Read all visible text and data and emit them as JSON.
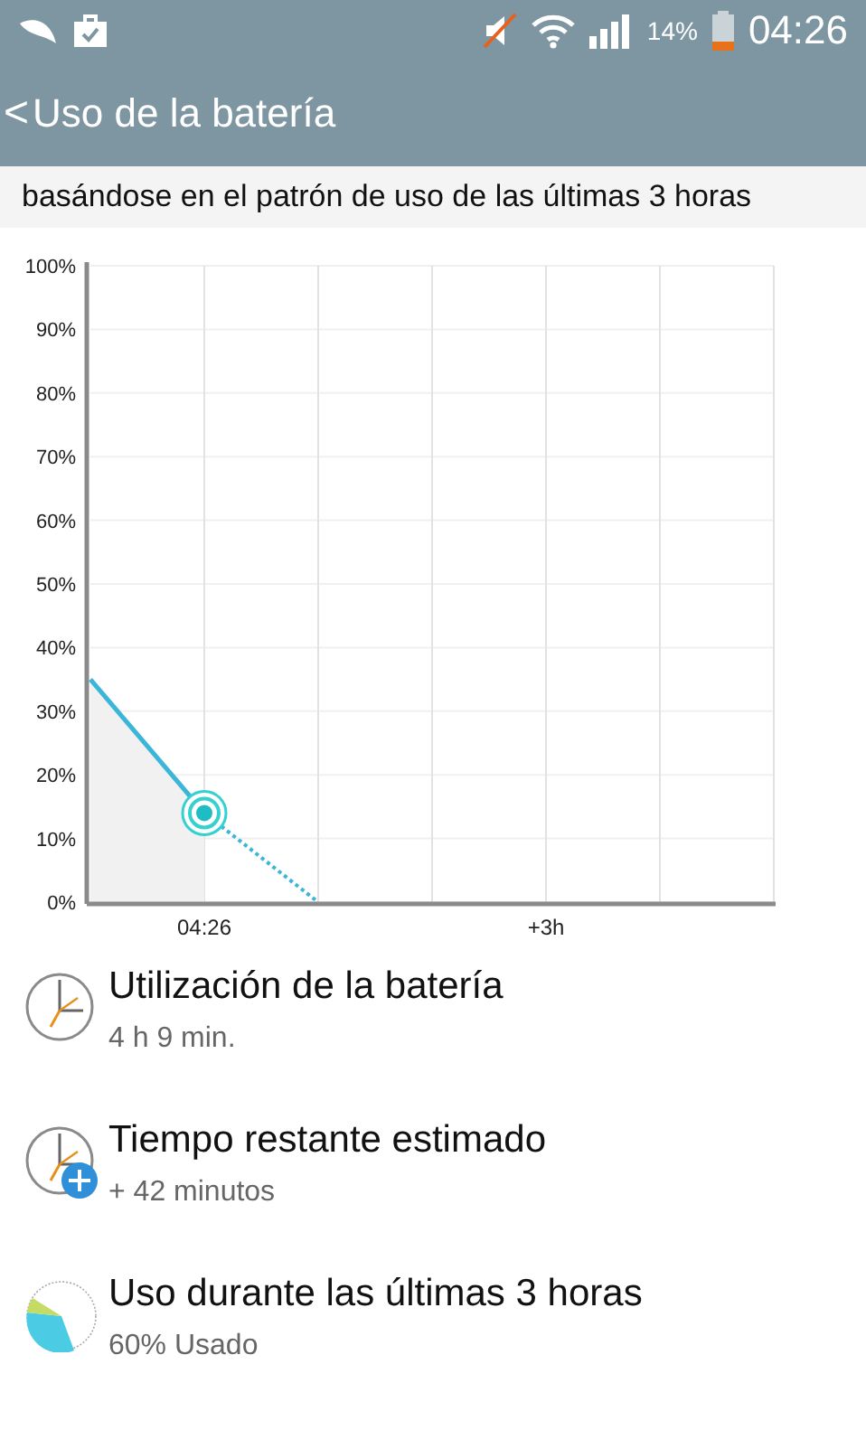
{
  "status_bar": {
    "battery_percent": "14%",
    "time": "04:26"
  },
  "header": {
    "back_icon": "<",
    "title": "Uso de la batería"
  },
  "subtitle": "basándose en el patrón de uso de las últimas 3 horas",
  "chart": {
    "chart_data": {
      "type": "line",
      "categories": [
        null,
        "04:26",
        null,
        null,
        "+3h",
        null,
        null
      ],
      "ylim": [
        0,
        100
      ],
      "grid": true,
      "yticks": [
        {
          "value": 0,
          "label": "0%"
        },
        {
          "value": 10,
          "label": "10%"
        },
        {
          "value": 20,
          "label": "20%"
        },
        {
          "value": 30,
          "label": "30%"
        },
        {
          "value": 40,
          "label": "40%"
        },
        {
          "value": 50,
          "label": "50%"
        },
        {
          "value": 60,
          "label": "60%"
        },
        {
          "value": 70,
          "label": "70%"
        },
        {
          "value": 80,
          "label": "80%"
        },
        {
          "value": 90,
          "label": "90%"
        },
        {
          "value": 100,
          "label": "100%"
        }
      ],
      "series": [
        {
          "color": "#3bb6d8",
          "line_style": "solid",
          "values": [
            35,
            14,
            null,
            null,
            null,
            null,
            null
          ]
        },
        {
          "color": "#3bb6d8",
          "line_style": "dotted",
          "values": [
            null,
            14,
            0,
            null,
            null,
            null,
            null
          ]
        }
      ]
    }
  },
  "items": [
    {
      "kind": "clock",
      "title": "Utilización de la batería",
      "detail": "4 h 9 min."
    },
    {
      "kind": "clock-plus",
      "title": "Tiempo restante estimado",
      "detail": "+ 42 minutos"
    },
    {
      "kind": "pie",
      "title": "Uso durante las últimas 3 horas",
      "detail": "60% Usado"
    }
  ]
}
